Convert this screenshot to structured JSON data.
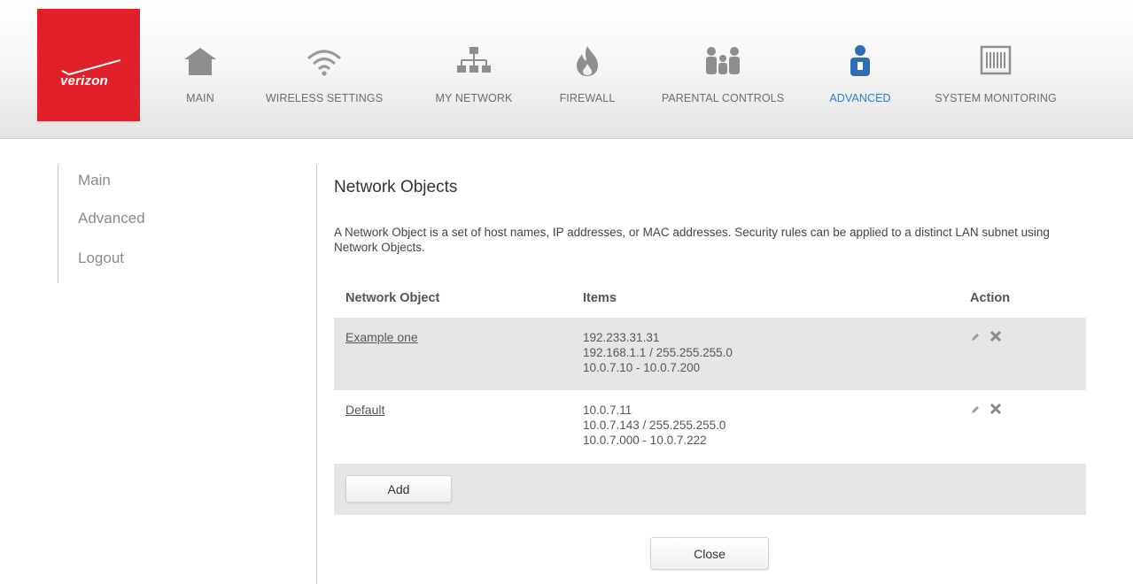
{
  "brand": {
    "logo_text": "verizon",
    "logo_color": "#e2202a"
  },
  "nav": {
    "accent_color": "#3a78c2",
    "items": [
      {
        "label": "MAIN",
        "icon": "home-icon",
        "active": false
      },
      {
        "label": "WIRELESS SETTINGS",
        "icon": "wifi-icon",
        "active": false
      },
      {
        "label": "MY NETWORK",
        "icon": "network-icon",
        "active": false
      },
      {
        "label": "FIREWALL",
        "icon": "flame-icon",
        "active": false
      },
      {
        "label": "PARENTAL CONTROLS",
        "icon": "family-icon",
        "active": false
      },
      {
        "label": "ADVANCED",
        "icon": "advanced-user-icon",
        "active": true
      },
      {
        "label": "SYSTEM MONITORING",
        "icon": "monitor-icon",
        "active": false
      }
    ]
  },
  "sidebar": {
    "items": [
      {
        "label": "Main"
      },
      {
        "label": "Advanced"
      },
      {
        "label": "Logout"
      }
    ]
  },
  "content": {
    "title": "Network Objects",
    "description": "A Network Object is a set of host names, IP addresses, or MAC addresses. Security rules can be applied to a distinct LAN subnet using Network Objects.",
    "columns": [
      "Network Object",
      "Items",
      "Action"
    ],
    "rows": [
      {
        "name": "Example one",
        "items": [
          "192.233.31.31",
          "192.168.1.1 / 255.255.255.0",
          "10.0.7.10 - 10.0.7.200"
        ]
      },
      {
        "name": "Default",
        "items": [
          "10.0.7.11",
          "10.0.7.143 / 255.255.255.0",
          "10.0.7.000 - 10.0.7.222"
        ]
      }
    ],
    "add_label": "Add",
    "close_label": "Close"
  }
}
